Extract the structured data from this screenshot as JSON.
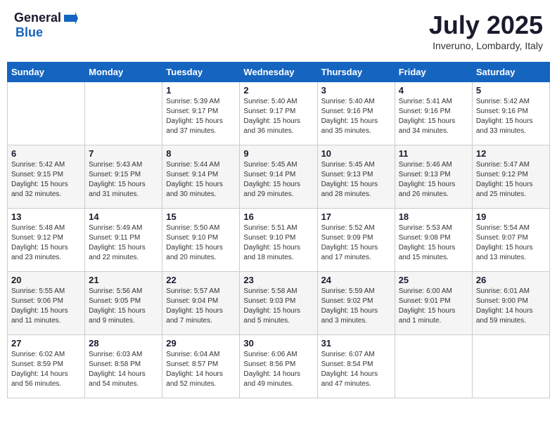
{
  "logo": {
    "general": "General",
    "blue": "Blue",
    "arrow_color": "#1565c0"
  },
  "title": {
    "month_year": "July 2025",
    "location": "Inveruno, Lombardy, Italy"
  },
  "days_of_week": [
    "Sunday",
    "Monday",
    "Tuesday",
    "Wednesday",
    "Thursday",
    "Friday",
    "Saturday"
  ],
  "weeks": [
    [
      {
        "day": "",
        "sunrise": "",
        "sunset": "",
        "daylight": ""
      },
      {
        "day": "",
        "sunrise": "",
        "sunset": "",
        "daylight": ""
      },
      {
        "day": "1",
        "sunrise": "Sunrise: 5:39 AM",
        "sunset": "Sunset: 9:17 PM",
        "daylight": "Daylight: 15 hours and 37 minutes."
      },
      {
        "day": "2",
        "sunrise": "Sunrise: 5:40 AM",
        "sunset": "Sunset: 9:17 PM",
        "daylight": "Daylight: 15 hours and 36 minutes."
      },
      {
        "day": "3",
        "sunrise": "Sunrise: 5:40 AM",
        "sunset": "Sunset: 9:16 PM",
        "daylight": "Daylight: 15 hours and 35 minutes."
      },
      {
        "day": "4",
        "sunrise": "Sunrise: 5:41 AM",
        "sunset": "Sunset: 9:16 PM",
        "daylight": "Daylight: 15 hours and 34 minutes."
      },
      {
        "day": "5",
        "sunrise": "Sunrise: 5:42 AM",
        "sunset": "Sunset: 9:16 PM",
        "daylight": "Daylight: 15 hours and 33 minutes."
      }
    ],
    [
      {
        "day": "6",
        "sunrise": "Sunrise: 5:42 AM",
        "sunset": "Sunset: 9:15 PM",
        "daylight": "Daylight: 15 hours and 32 minutes."
      },
      {
        "day": "7",
        "sunrise": "Sunrise: 5:43 AM",
        "sunset": "Sunset: 9:15 PM",
        "daylight": "Daylight: 15 hours and 31 minutes."
      },
      {
        "day": "8",
        "sunrise": "Sunrise: 5:44 AM",
        "sunset": "Sunset: 9:14 PM",
        "daylight": "Daylight: 15 hours and 30 minutes."
      },
      {
        "day": "9",
        "sunrise": "Sunrise: 5:45 AM",
        "sunset": "Sunset: 9:14 PM",
        "daylight": "Daylight: 15 hours and 29 minutes."
      },
      {
        "day": "10",
        "sunrise": "Sunrise: 5:45 AM",
        "sunset": "Sunset: 9:13 PM",
        "daylight": "Daylight: 15 hours and 28 minutes."
      },
      {
        "day": "11",
        "sunrise": "Sunrise: 5:46 AM",
        "sunset": "Sunset: 9:13 PM",
        "daylight": "Daylight: 15 hours and 26 minutes."
      },
      {
        "day": "12",
        "sunrise": "Sunrise: 5:47 AM",
        "sunset": "Sunset: 9:12 PM",
        "daylight": "Daylight: 15 hours and 25 minutes."
      }
    ],
    [
      {
        "day": "13",
        "sunrise": "Sunrise: 5:48 AM",
        "sunset": "Sunset: 9:12 PM",
        "daylight": "Daylight: 15 hours and 23 minutes."
      },
      {
        "day": "14",
        "sunrise": "Sunrise: 5:49 AM",
        "sunset": "Sunset: 9:11 PM",
        "daylight": "Daylight: 15 hours and 22 minutes."
      },
      {
        "day": "15",
        "sunrise": "Sunrise: 5:50 AM",
        "sunset": "Sunset: 9:10 PM",
        "daylight": "Daylight: 15 hours and 20 minutes."
      },
      {
        "day": "16",
        "sunrise": "Sunrise: 5:51 AM",
        "sunset": "Sunset: 9:10 PM",
        "daylight": "Daylight: 15 hours and 18 minutes."
      },
      {
        "day": "17",
        "sunrise": "Sunrise: 5:52 AM",
        "sunset": "Sunset: 9:09 PM",
        "daylight": "Daylight: 15 hours and 17 minutes."
      },
      {
        "day": "18",
        "sunrise": "Sunrise: 5:53 AM",
        "sunset": "Sunset: 9:08 PM",
        "daylight": "Daylight: 15 hours and 15 minutes."
      },
      {
        "day": "19",
        "sunrise": "Sunrise: 5:54 AM",
        "sunset": "Sunset: 9:07 PM",
        "daylight": "Daylight: 15 hours and 13 minutes."
      }
    ],
    [
      {
        "day": "20",
        "sunrise": "Sunrise: 5:55 AM",
        "sunset": "Sunset: 9:06 PM",
        "daylight": "Daylight: 15 hours and 11 minutes."
      },
      {
        "day": "21",
        "sunrise": "Sunrise: 5:56 AM",
        "sunset": "Sunset: 9:05 PM",
        "daylight": "Daylight: 15 hours and 9 minutes."
      },
      {
        "day": "22",
        "sunrise": "Sunrise: 5:57 AM",
        "sunset": "Sunset: 9:04 PM",
        "daylight": "Daylight: 15 hours and 7 minutes."
      },
      {
        "day": "23",
        "sunrise": "Sunrise: 5:58 AM",
        "sunset": "Sunset: 9:03 PM",
        "daylight": "Daylight: 15 hours and 5 minutes."
      },
      {
        "day": "24",
        "sunrise": "Sunrise: 5:59 AM",
        "sunset": "Sunset: 9:02 PM",
        "daylight": "Daylight: 15 hours and 3 minutes."
      },
      {
        "day": "25",
        "sunrise": "Sunrise: 6:00 AM",
        "sunset": "Sunset: 9:01 PM",
        "daylight": "Daylight: 15 hours and 1 minute."
      },
      {
        "day": "26",
        "sunrise": "Sunrise: 6:01 AM",
        "sunset": "Sunset: 9:00 PM",
        "daylight": "Daylight: 14 hours and 59 minutes."
      }
    ],
    [
      {
        "day": "27",
        "sunrise": "Sunrise: 6:02 AM",
        "sunset": "Sunset: 8:59 PM",
        "daylight": "Daylight: 14 hours and 56 minutes."
      },
      {
        "day": "28",
        "sunrise": "Sunrise: 6:03 AM",
        "sunset": "Sunset: 8:58 PM",
        "daylight": "Daylight: 14 hours and 54 minutes."
      },
      {
        "day": "29",
        "sunrise": "Sunrise: 6:04 AM",
        "sunset": "Sunset: 8:57 PM",
        "daylight": "Daylight: 14 hours and 52 minutes."
      },
      {
        "day": "30",
        "sunrise": "Sunrise: 6:06 AM",
        "sunset": "Sunset: 8:56 PM",
        "daylight": "Daylight: 14 hours and 49 minutes."
      },
      {
        "day": "31",
        "sunrise": "Sunrise: 6:07 AM",
        "sunset": "Sunset: 8:54 PM",
        "daylight": "Daylight: 14 hours and 47 minutes."
      },
      {
        "day": "",
        "sunrise": "",
        "sunset": "",
        "daylight": ""
      },
      {
        "day": "",
        "sunrise": "",
        "sunset": "",
        "daylight": ""
      }
    ]
  ]
}
